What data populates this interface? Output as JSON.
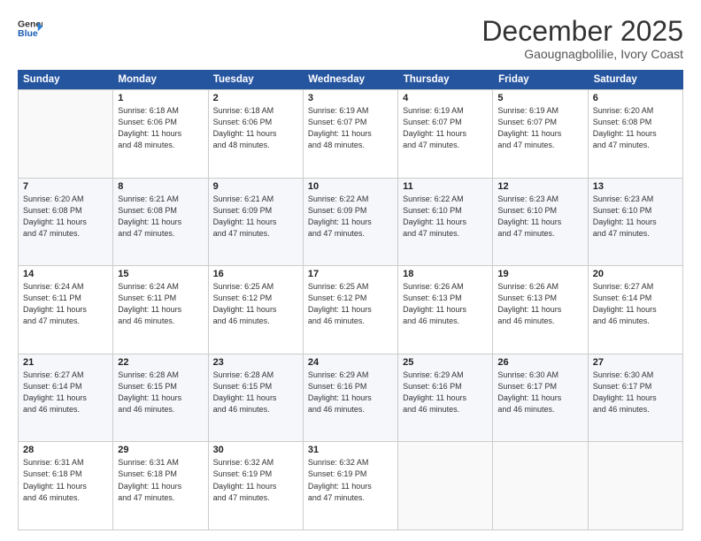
{
  "header": {
    "logo_line1": "General",
    "logo_line2": "Blue",
    "month": "December 2025",
    "location": "Gaougnagbolilie, Ivory Coast"
  },
  "weekdays": [
    "Sunday",
    "Monday",
    "Tuesday",
    "Wednesday",
    "Thursday",
    "Friday",
    "Saturday"
  ],
  "rows": [
    [
      {
        "day": "",
        "info": ""
      },
      {
        "day": "1",
        "info": "Sunrise: 6:18 AM\nSunset: 6:06 PM\nDaylight: 11 hours\nand 48 minutes."
      },
      {
        "day": "2",
        "info": "Sunrise: 6:18 AM\nSunset: 6:06 PM\nDaylight: 11 hours\nand 48 minutes."
      },
      {
        "day": "3",
        "info": "Sunrise: 6:19 AM\nSunset: 6:07 PM\nDaylight: 11 hours\nand 48 minutes."
      },
      {
        "day": "4",
        "info": "Sunrise: 6:19 AM\nSunset: 6:07 PM\nDaylight: 11 hours\nand 47 minutes."
      },
      {
        "day": "5",
        "info": "Sunrise: 6:19 AM\nSunset: 6:07 PM\nDaylight: 11 hours\nand 47 minutes."
      },
      {
        "day": "6",
        "info": "Sunrise: 6:20 AM\nSunset: 6:08 PM\nDaylight: 11 hours\nand 47 minutes."
      }
    ],
    [
      {
        "day": "7",
        "info": "Sunrise: 6:20 AM\nSunset: 6:08 PM\nDaylight: 11 hours\nand 47 minutes."
      },
      {
        "day": "8",
        "info": "Sunrise: 6:21 AM\nSunset: 6:08 PM\nDaylight: 11 hours\nand 47 minutes."
      },
      {
        "day": "9",
        "info": "Sunrise: 6:21 AM\nSunset: 6:09 PM\nDaylight: 11 hours\nand 47 minutes."
      },
      {
        "day": "10",
        "info": "Sunrise: 6:22 AM\nSunset: 6:09 PM\nDaylight: 11 hours\nand 47 minutes."
      },
      {
        "day": "11",
        "info": "Sunrise: 6:22 AM\nSunset: 6:10 PM\nDaylight: 11 hours\nand 47 minutes."
      },
      {
        "day": "12",
        "info": "Sunrise: 6:23 AM\nSunset: 6:10 PM\nDaylight: 11 hours\nand 47 minutes."
      },
      {
        "day": "13",
        "info": "Sunrise: 6:23 AM\nSunset: 6:10 PM\nDaylight: 11 hours\nand 47 minutes."
      }
    ],
    [
      {
        "day": "14",
        "info": "Sunrise: 6:24 AM\nSunset: 6:11 PM\nDaylight: 11 hours\nand 47 minutes."
      },
      {
        "day": "15",
        "info": "Sunrise: 6:24 AM\nSunset: 6:11 PM\nDaylight: 11 hours\nand 46 minutes."
      },
      {
        "day": "16",
        "info": "Sunrise: 6:25 AM\nSunset: 6:12 PM\nDaylight: 11 hours\nand 46 minutes."
      },
      {
        "day": "17",
        "info": "Sunrise: 6:25 AM\nSunset: 6:12 PM\nDaylight: 11 hours\nand 46 minutes."
      },
      {
        "day": "18",
        "info": "Sunrise: 6:26 AM\nSunset: 6:13 PM\nDaylight: 11 hours\nand 46 minutes."
      },
      {
        "day": "19",
        "info": "Sunrise: 6:26 AM\nSunset: 6:13 PM\nDaylight: 11 hours\nand 46 minutes."
      },
      {
        "day": "20",
        "info": "Sunrise: 6:27 AM\nSunset: 6:14 PM\nDaylight: 11 hours\nand 46 minutes."
      }
    ],
    [
      {
        "day": "21",
        "info": "Sunrise: 6:27 AM\nSunset: 6:14 PM\nDaylight: 11 hours\nand 46 minutes."
      },
      {
        "day": "22",
        "info": "Sunrise: 6:28 AM\nSunset: 6:15 PM\nDaylight: 11 hours\nand 46 minutes."
      },
      {
        "day": "23",
        "info": "Sunrise: 6:28 AM\nSunset: 6:15 PM\nDaylight: 11 hours\nand 46 minutes."
      },
      {
        "day": "24",
        "info": "Sunrise: 6:29 AM\nSunset: 6:16 PM\nDaylight: 11 hours\nand 46 minutes."
      },
      {
        "day": "25",
        "info": "Sunrise: 6:29 AM\nSunset: 6:16 PM\nDaylight: 11 hours\nand 46 minutes."
      },
      {
        "day": "26",
        "info": "Sunrise: 6:30 AM\nSunset: 6:17 PM\nDaylight: 11 hours\nand 46 minutes."
      },
      {
        "day": "27",
        "info": "Sunrise: 6:30 AM\nSunset: 6:17 PM\nDaylight: 11 hours\nand 46 minutes."
      }
    ],
    [
      {
        "day": "28",
        "info": "Sunrise: 6:31 AM\nSunset: 6:18 PM\nDaylight: 11 hours\nand 46 minutes."
      },
      {
        "day": "29",
        "info": "Sunrise: 6:31 AM\nSunset: 6:18 PM\nDaylight: 11 hours\nand 47 minutes."
      },
      {
        "day": "30",
        "info": "Sunrise: 6:32 AM\nSunset: 6:19 PM\nDaylight: 11 hours\nand 47 minutes."
      },
      {
        "day": "31",
        "info": "Sunrise: 6:32 AM\nSunset: 6:19 PM\nDaylight: 11 hours\nand 47 minutes."
      },
      {
        "day": "",
        "info": ""
      },
      {
        "day": "",
        "info": ""
      },
      {
        "day": "",
        "info": ""
      }
    ]
  ]
}
